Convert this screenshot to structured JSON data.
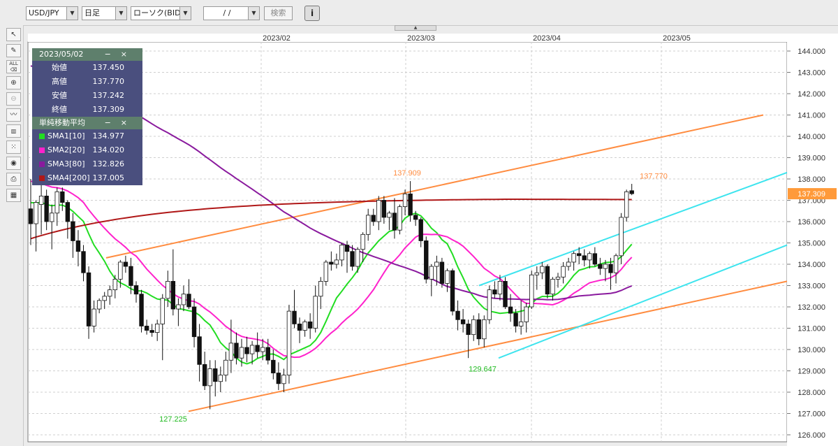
{
  "toolbar": {
    "pair": "USD/JPY",
    "period": "日足",
    "chart_kind": "ローソク(BID)",
    "date": "/ /",
    "search_label": "検索",
    "info_label": "i"
  },
  "tools": [
    "pointer-tool",
    "pencil-tool",
    "all-delete-tool",
    "zoom-in-tool",
    "zoom-out-tool",
    "indicator-tool",
    "bar-settings-tool",
    "style-tool",
    "view-tool",
    "print-tool",
    "layout-tool"
  ],
  "ohlc_panel": {
    "date": "2023/05/02",
    "rows": [
      {
        "label": "始値",
        "value": "137.450"
      },
      {
        "label": "高値",
        "value": "137.770"
      },
      {
        "label": "安値",
        "value": "137.242"
      },
      {
        "label": "終値",
        "value": "137.309"
      }
    ]
  },
  "sma_panel": {
    "title": "単純移動平均",
    "rows": [
      {
        "label": "SMA1[10]",
        "value": "134.977",
        "color": "#22dd22"
      },
      {
        "label": "SMA2[20]",
        "value": "134.020",
        "color": "#ff22cc"
      },
      {
        "label": "SMA3[80]",
        "value": "132.826",
        "color": "#8a1a9e"
      },
      {
        "label": "SMA4[200]",
        "value": "137.005",
        "color": "#b01818"
      }
    ]
  },
  "chart_data": {
    "type": "candlestick",
    "x_labels": [
      "2023/02",
      "2023/03",
      "2023/04",
      "2023/05"
    ],
    "y_ticks": [
      "144.000",
      "143.000",
      "142.000",
      "141.000",
      "140.000",
      "139.000",
      "138.000",
      "137.000",
      "136.000",
      "135.000",
      "134.000",
      "133.000",
      "132.000",
      "131.000",
      "130.000",
      "129.000",
      "128.000",
      "127.000",
      "126.000"
    ],
    "ylim": [
      126,
      144
    ],
    "current_price": "137.309",
    "annotations": [
      "127.225",
      "137.909",
      "129.647",
      "137.770"
    ],
    "candles": [
      [
        136.6,
        138.0,
        134.9,
        135.9
      ],
      [
        135.9,
        137.0,
        134.6,
        136.9
      ],
      [
        136.8,
        137.9,
        135.4,
        137.2
      ],
      [
        137.2,
        137.5,
        135.6,
        136.0
      ],
      [
        136.0,
        136.8,
        134.7,
        136.4
      ],
      [
        136.4,
        137.6,
        135.8,
        137.4
      ],
      [
        137.4,
        137.6,
        136.5,
        136.9
      ],
      [
        136.9,
        137.0,
        135.2,
        136.0
      ],
      [
        136.0,
        136.4,
        134.3,
        135.1
      ],
      [
        135.1,
        135.6,
        133.9,
        134.6
      ],
      [
        134.6,
        134.9,
        133.2,
        133.6
      ],
      [
        133.6,
        133.9,
        130.5,
        131.1
      ],
      [
        131.1,
        132.3,
        130.8,
        131.9
      ],
      [
        131.9,
        132.4,
        131.7,
        132.3
      ],
      [
        132.3,
        132.7,
        131.9,
        132.5
      ],
      [
        132.5,
        133.0,
        132.1,
        132.8
      ],
      [
        132.8,
        133.5,
        132.4,
        133.3
      ],
      [
        133.3,
        134.2,
        132.9,
        134.1
      ],
      [
        134.1,
        134.4,
        133.6,
        133.9
      ],
      [
        133.9,
        134.3,
        132.6,
        133.0
      ],
      [
        133.0,
        133.2,
        132.2,
        132.6
      ],
      [
        132.6,
        132.8,
        130.8,
        131.1
      ],
      [
        131.1,
        131.4,
        130.7,
        130.9
      ],
      [
        130.9,
        131.2,
        130.6,
        130.8
      ],
      [
        130.8,
        131.4,
        130.4,
        131.2
      ],
      [
        131.2,
        132.6,
        129.5,
        132.4
      ],
      [
        132.4,
        133.7,
        132.0,
        133.2
      ],
      [
        133.2,
        134.7,
        131.6,
        131.9
      ],
      [
        131.9,
        132.4,
        131.1,
        132.1
      ],
      [
        132.1,
        133.0,
        131.8,
        132.6
      ],
      [
        132.6,
        133.3,
        131.9,
        132.0
      ],
      [
        132.0,
        132.4,
        130.1,
        130.6
      ],
      [
        130.6,
        131.2,
        128.5,
        129.3
      ],
      [
        129.3,
        129.9,
        128.1,
        128.3
      ],
      [
        128.3,
        129.5,
        127.2,
        129.1
      ],
      [
        129.1,
        129.5,
        127.8,
        128.5
      ],
      [
        128.5,
        129.2,
        128.0,
        128.8
      ],
      [
        128.8,
        129.9,
        128.5,
        129.5
      ],
      [
        129.5,
        131.4,
        128.9,
        130.3
      ],
      [
        130.3,
        130.8,
        129.3,
        129.6
      ],
      [
        129.6,
        130.5,
        129.2,
        130.1
      ],
      [
        130.1,
        130.6,
        129.4,
        129.8
      ],
      [
        129.8,
        130.4,
        129.3,
        130.2
      ],
      [
        130.2,
        130.8,
        129.6,
        129.9
      ],
      [
        129.9,
        130.5,
        129.5,
        130.1
      ],
      [
        130.1,
        130.5,
        129.3,
        129.5
      ],
      [
        129.5,
        130.0,
        128.6,
        128.9
      ],
      [
        128.9,
        129.4,
        128.1,
        128.4
      ],
      [
        128.4,
        129.1,
        128.0,
        128.8
      ],
      [
        128.8,
        132.1,
        128.4,
        131.8
      ],
      [
        131.8,
        132.8,
        131.0,
        131.2
      ],
      [
        131.2,
        131.5,
        130.3,
        130.9
      ],
      [
        130.9,
        131.4,
        130.6,
        131.3
      ],
      [
        131.3,
        131.7,
        130.5,
        131.0
      ],
      [
        131.0,
        133.0,
        130.8,
        132.5
      ],
      [
        132.5,
        133.4,
        131.9,
        133.2
      ],
      [
        133.2,
        134.2,
        133.0,
        134.1
      ],
      [
        134.1,
        134.6,
        133.7,
        134.0
      ],
      [
        134.0,
        134.5,
        133.8,
        134.2
      ],
      [
        134.2,
        135.0,
        133.9,
        134.9
      ],
      [
        134.9,
        135.1,
        133.6,
        134.6
      ],
      [
        134.6,
        134.9,
        133.7,
        133.9
      ],
      [
        133.9,
        134.8,
        133.6,
        134.7
      ],
      [
        134.7,
        135.5,
        134.1,
        135.4
      ],
      [
        135.4,
        136.6,
        135.1,
        136.3
      ],
      [
        136.3,
        136.6,
        135.8,
        136.0
      ],
      [
        136.0,
        137.2,
        135.6,
        137.0
      ],
      [
        137.0,
        137.2,
        135.9,
        136.2
      ],
      [
        136.2,
        136.5,
        135.6,
        136.4
      ],
      [
        136.4,
        137.1,
        135.2,
        135.6
      ],
      [
        135.6,
        136.8,
        135.4,
        136.7
      ],
      [
        136.7,
        137.5,
        136.3,
        137.3
      ],
      [
        137.3,
        137.9,
        136.0,
        136.3
      ],
      [
        136.3,
        136.5,
        135.8,
        136.1
      ],
      [
        136.1,
        136.2,
        134.8,
        135.1
      ],
      [
        135.1,
        135.3,
        133.1,
        133.3
      ],
      [
        133.3,
        134.0,
        132.5,
        133.9
      ],
      [
        133.9,
        134.4,
        133.0,
        134.1
      ],
      [
        134.1,
        134.3,
        132.9,
        133.1
      ],
      [
        133.1,
        133.8,
        132.7,
        133.7
      ],
      [
        133.7,
        133.8,
        131.6,
        131.8
      ],
      [
        131.8,
        132.3,
        130.9,
        131.4
      ],
      [
        131.4,
        131.9,
        130.8,
        131.2
      ],
      [
        131.2,
        131.4,
        129.6,
        130.7
      ],
      [
        130.7,
        131.6,
        130.4,
        131.4
      ],
      [
        131.4,
        131.7,
        130.2,
        130.5
      ],
      [
        130.5,
        131.6,
        130.1,
        131.4
      ],
      [
        131.4,
        133.0,
        131.2,
        132.8
      ],
      [
        132.8,
        133.2,
        132.4,
        132.6
      ],
      [
        132.6,
        133.5,
        132.3,
        133.2
      ],
      [
        133.2,
        133.4,
        131.9,
        132.0
      ],
      [
        132.0,
        132.6,
        131.3,
        131.7
      ],
      [
        131.7,
        131.9,
        130.8,
        131.1
      ],
      [
        131.1,
        132.3,
        130.7,
        131.3
      ],
      [
        131.3,
        132.2,
        130.8,
        132.0
      ],
      [
        132.0,
        133.7,
        131.9,
        133.5
      ],
      [
        133.5,
        133.9,
        132.8,
        133.6
      ],
      [
        133.6,
        134.1,
        133.3,
        133.9
      ],
      [
        133.9,
        134.0,
        132.4,
        132.6
      ],
      [
        132.6,
        133.4,
        132.3,
        133.3
      ],
      [
        133.3,
        133.6,
        132.9,
        133.4
      ],
      [
        133.4,
        134.1,
        133.1,
        133.9
      ],
      [
        133.9,
        134.3,
        133.7,
        134.1
      ],
      [
        134.1,
        134.6,
        133.7,
        134.5
      ],
      [
        134.5,
        134.8,
        134.0,
        134.4
      ],
      [
        134.4,
        134.7,
        133.9,
        134.2
      ],
      [
        134.2,
        134.6,
        133.8,
        134.5
      ],
      [
        134.5,
        134.8,
        133.9,
        134.0
      ],
      [
        134.0,
        134.3,
        133.5,
        133.8
      ],
      [
        133.8,
        134.2,
        133.2,
        134.0
      ],
      [
        134.0,
        134.3,
        132.8,
        133.6
      ],
      [
        133.6,
        134.5,
        133.1,
        134.4
      ],
      [
        134.4,
        136.4,
        134.0,
        136.2
      ],
      [
        136.2,
        137.5,
        136.0,
        137.4
      ],
      [
        137.45,
        137.77,
        137.24,
        137.309
      ]
    ]
  }
}
